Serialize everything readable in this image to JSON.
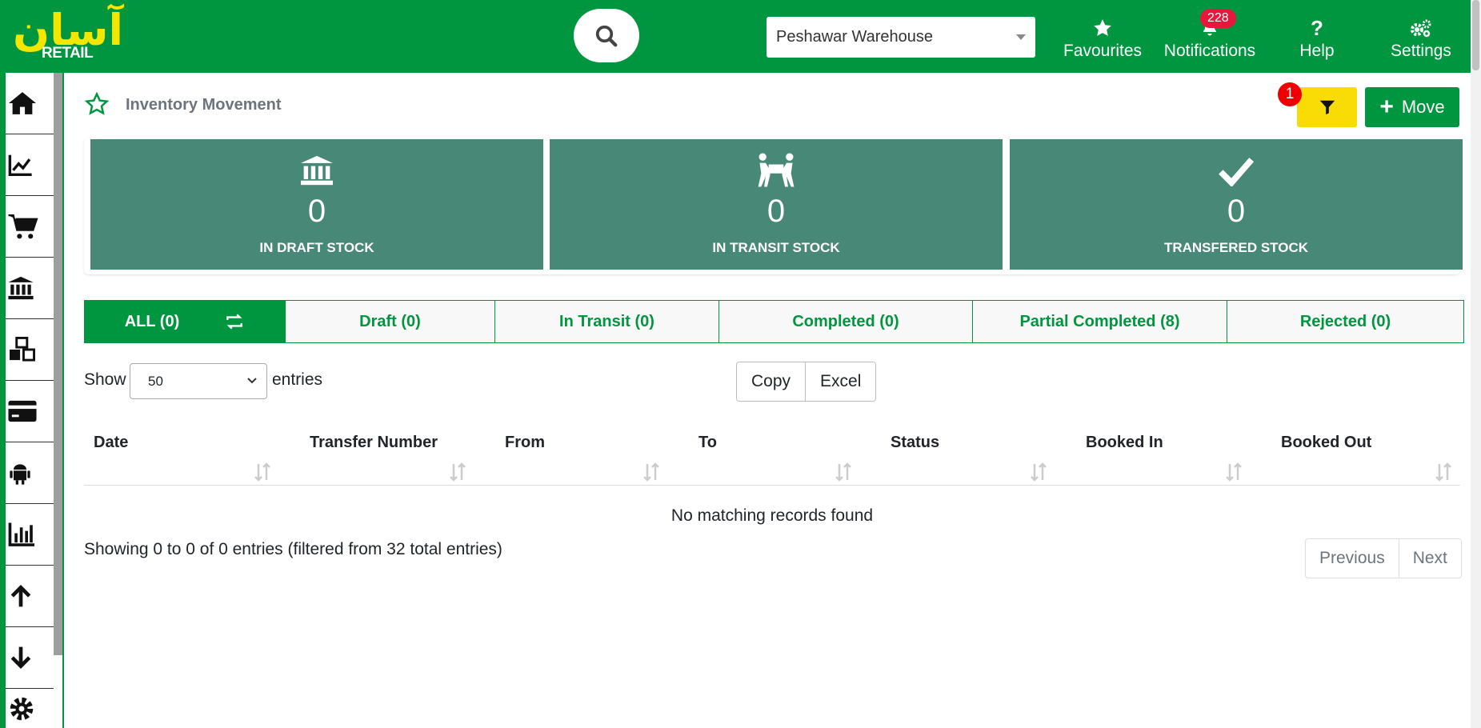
{
  "header": {
    "logo_urdu": "آسان",
    "logo_sub": "RETAIL",
    "warehouse": "Peshawar Warehouse",
    "nav": [
      {
        "label": "Favourites",
        "icon": "star-icon"
      },
      {
        "label": "Notifications",
        "icon": "bell-icon",
        "badge": "228"
      },
      {
        "label": "Help",
        "icon": "question-icon"
      },
      {
        "label": "Settings",
        "icon": "gears-icon"
      }
    ]
  },
  "sidebar": {
    "items": [
      {
        "icon": "home-icon"
      },
      {
        "icon": "chart-line-icon"
      },
      {
        "icon": "cart-icon"
      },
      {
        "icon": "bank-icon"
      },
      {
        "icon": "cubes-icon"
      },
      {
        "icon": "credit-card-icon"
      },
      {
        "icon": "android-icon"
      },
      {
        "icon": "bar-chart-icon"
      },
      {
        "icon": "arrow-up-icon"
      },
      {
        "icon": "arrow-down-icon"
      },
      {
        "icon": "gear-icon"
      }
    ]
  },
  "page": {
    "title": "Inventory Movement",
    "filter_badge": "1",
    "move_label": "Move"
  },
  "cards": [
    {
      "value": "0",
      "label": "IN DRAFT STOCK",
      "icon": "bank-icon"
    },
    {
      "value": "0",
      "label": "IN TRANSIT STOCK",
      "icon": "people-carry-icon"
    },
    {
      "value": "0",
      "label": "TRANSFERED STOCK",
      "icon": "check-icon"
    }
  ],
  "tabs": [
    {
      "label": "ALL (0)"
    },
    {
      "label": "Draft (0)"
    },
    {
      "label": "In Transit (0)"
    },
    {
      "label": "Completed (0)"
    },
    {
      "label": "Partial Completed (8)"
    },
    {
      "label": "Rejected (0)"
    }
  ],
  "table": {
    "show_label": "Show",
    "entries_value": "50",
    "entries_label": "entries",
    "buttons": {
      "copy": "Copy",
      "excel": "Excel"
    },
    "columns": [
      "Date",
      "Transfer Number",
      "From",
      "To",
      "Status",
      "Booked In",
      "Booked Out"
    ],
    "empty_text": "No matching records found",
    "info": "Showing 0 to 0 of 0 entries (filtered from 32 total entries)",
    "pager": {
      "previous": "Previous",
      "next": "Next"
    }
  },
  "colors": {
    "brand_green": "#00963f",
    "card_teal": "#478877",
    "logo_yellow": "#f3e600",
    "filter_yellow": "#f9dc06",
    "badge_red": "#e5173b"
  }
}
